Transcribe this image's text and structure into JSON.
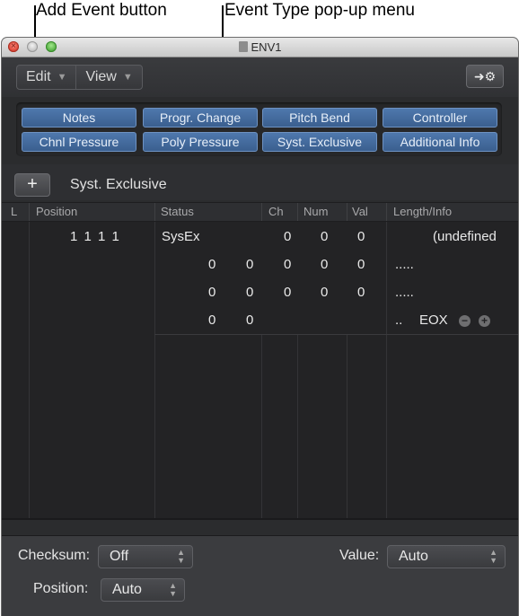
{
  "callouts": {
    "add_event": "Add Event button",
    "event_type": "Event Type pop-up menu"
  },
  "window": {
    "title": "ENV1"
  },
  "toolbar": {
    "edit_label": "Edit",
    "view_label": "View"
  },
  "filters": [
    "Notes",
    "Progr. Change",
    "Pitch Bend",
    "Controller",
    "Chnl Pressure",
    "Poly Pressure",
    "Syst. Exclusive",
    "Additional Info"
  ],
  "add_bar": {
    "add_symbol": "+",
    "event_type": "Syst. Exclusive"
  },
  "columns": [
    "L",
    "Position",
    "Status",
    "Ch",
    "Num",
    "Val",
    "Length/Info"
  ],
  "event": {
    "position": "1  1  1     1",
    "status": "SysEx",
    "ch": "0",
    "num": "0",
    "val": "0",
    "info": "(undefined"
  },
  "data_rows": [
    {
      "a": "0",
      "b": "0",
      "c": "0",
      "d": "0",
      "e": "0",
      "info": "....."
    },
    {
      "a": "0",
      "b": "0",
      "c": "0",
      "d": "0",
      "e": "0",
      "info": "....."
    },
    {
      "a": "0",
      "b": "0",
      "info": "..",
      "eox": "EOX"
    }
  ],
  "bottom": {
    "checksum_label": "Checksum:",
    "checksum_value": "Off",
    "value_label": "Value:",
    "value_value": "Auto",
    "position_label": "Position:",
    "position_value": "Auto"
  },
  "colors": {
    "accent_button": "#4a6fa0",
    "panel": "#2b2c2e"
  }
}
